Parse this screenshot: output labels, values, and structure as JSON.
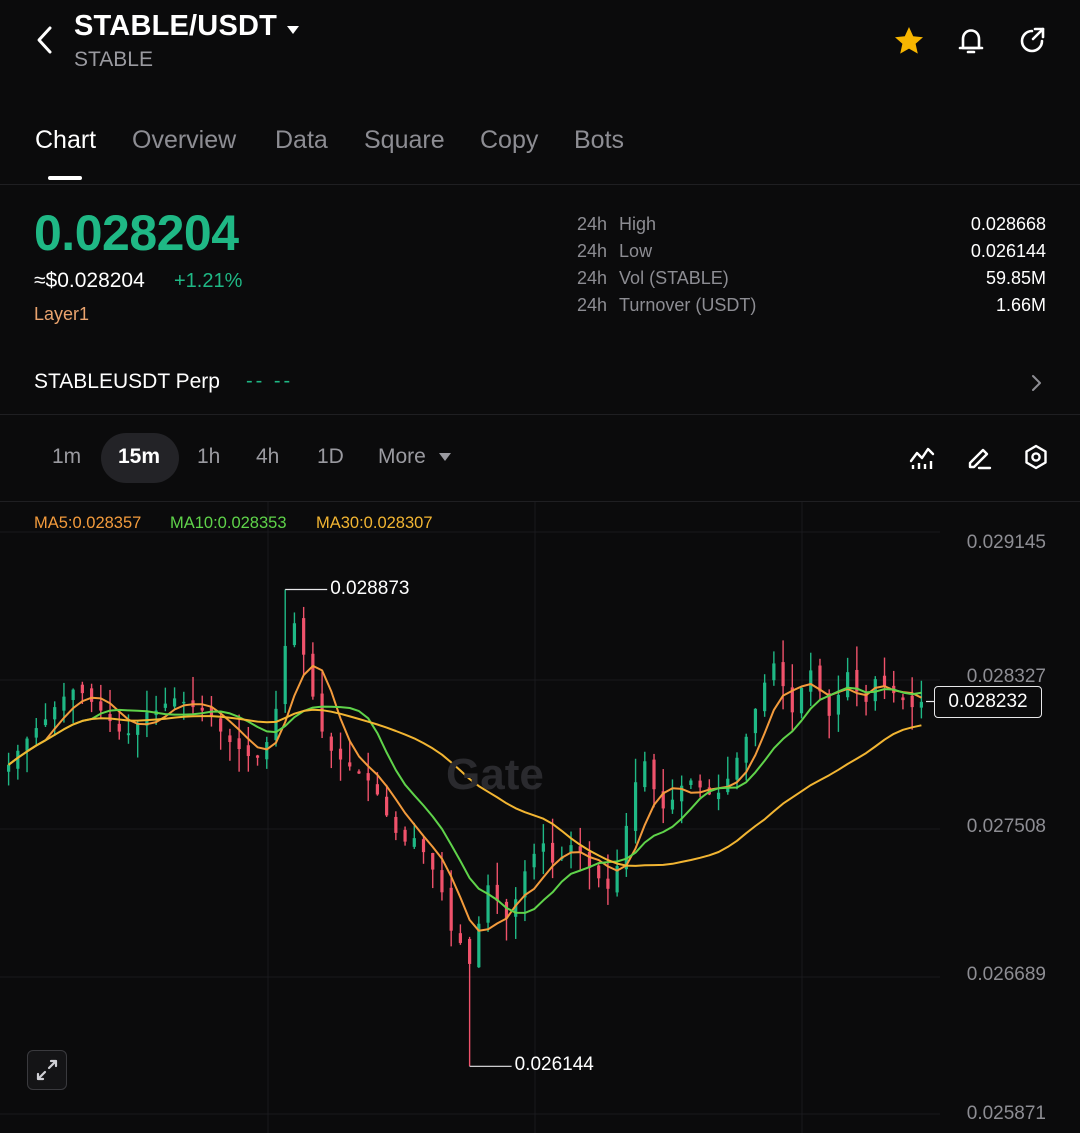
{
  "header": {
    "pair": "STABLE/USDT",
    "subtitle": "STABLE",
    "icons": [
      "back-arrow-icon",
      "chevron-down-icon",
      "star-icon",
      "bell-icon",
      "share-icon"
    ]
  },
  "tabs": [
    {
      "label": "Chart",
      "active": true
    },
    {
      "label": "Overview",
      "active": false
    },
    {
      "label": "Data",
      "active": false
    },
    {
      "label": "Square",
      "active": false
    },
    {
      "label": "Copy",
      "active": false
    },
    {
      "label": "Bots",
      "active": false
    }
  ],
  "ticker": {
    "last_price": "0.028204",
    "usd_price": "≈$0.028204",
    "change": "+1.21%",
    "tag": "Layer1",
    "stats": [
      {
        "period": "24h",
        "label": "High",
        "value": "0.028668"
      },
      {
        "period": "24h",
        "label": "Low",
        "value": "0.026144"
      },
      {
        "period": "24h",
        "label": "Vol (STABLE)",
        "value": "59.85M"
      },
      {
        "period": "24h",
        "label": "Turnover (USDT)",
        "value": "1.66M"
      }
    ]
  },
  "perp": {
    "name": "STABLEUSDT Perp",
    "value": "-- --"
  },
  "intervals": {
    "items": [
      "1m",
      "15m",
      "1h",
      "4h",
      "1D"
    ],
    "active": "15m",
    "more_label": "More",
    "tool_icons": [
      "indicator-icon",
      "draw-pen-icon",
      "settings-hexagon-icon"
    ]
  },
  "colors": {
    "up": "#1fb885",
    "down": "#f0526b",
    "ma5": "#f39b3c",
    "ma10": "#5fd34a",
    "ma30": "#f2b532",
    "tag": "#e9a36e",
    "star": "#f7b500"
  },
  "chart_data": {
    "type": "candlestick",
    "indicators": [
      {
        "name": "MA5",
        "label": "MA5:0.028357",
        "value": 0.028357
      },
      {
        "name": "MA10",
        "label": "MA10:0.028353",
        "value": 0.028353
      },
      {
        "name": "MA30",
        "label": "MA30:0.028307",
        "value": 0.028307
      }
    ],
    "y_ticks": [
      "0.029145",
      "0.028327",
      "0.027508",
      "0.026689",
      "0.025871"
    ],
    "ylim": [
      0.025871,
      0.029145
    ],
    "annotations": {
      "high_label": "0.028873",
      "high": 0.028873,
      "low_label": "0.026144",
      "low": 0.026144,
      "current_label": "0.028232",
      "current": 0.028232
    },
    "watermark": "Gate",
    "candles_approx": [
      0.02787,
      0.02795,
      0.02802,
      0.02808,
      0.02813,
      0.0282,
      0.02826,
      0.0283,
      0.02828,
      0.02823,
      0.02818,
      0.02812,
      0.02806,
      0.02805,
      0.02811,
      0.02817,
      0.02818,
      0.02822,
      0.02825,
      0.02823,
      0.0282,
      0.02818,
      0.02815,
      0.02806,
      0.028,
      0.02796,
      0.02792,
      0.02791,
      0.028,
      0.02819,
      0.02855,
      0.02868,
      0.0285,
      0.02826,
      0.02806,
      0.02795,
      0.0279,
      0.02786,
      0.02782,
      0.02778,
      0.0277,
      0.02758,
      0.02748,
      0.02743,
      0.02745,
      0.02737,
      0.02727,
      0.02714,
      0.02692,
      0.02685,
      0.02673,
      0.02696,
      0.02718,
      0.02709,
      0.02699,
      0.0271,
      0.02726,
      0.02736,
      0.02742,
      0.02731,
      0.02734,
      0.02741,
      0.02737,
      0.02728,
      0.02722,
      0.02716,
      0.02729,
      0.02752,
      0.02777,
      0.02789,
      0.02773,
      0.02762,
      0.02767,
      0.02775,
      0.02778,
      0.02774,
      0.0277,
      0.02771,
      0.02779,
      0.02791,
      0.02803,
      0.02819,
      0.02834,
      0.02845,
      0.02832,
      0.02817,
      0.02831,
      0.02841,
      0.02829,
      0.02815,
      0.02827,
      0.0284,
      0.02829,
      0.02823,
      0.02836,
      0.02832,
      0.02828,
      0.02824,
      0.0282,
      0.02823
    ]
  }
}
